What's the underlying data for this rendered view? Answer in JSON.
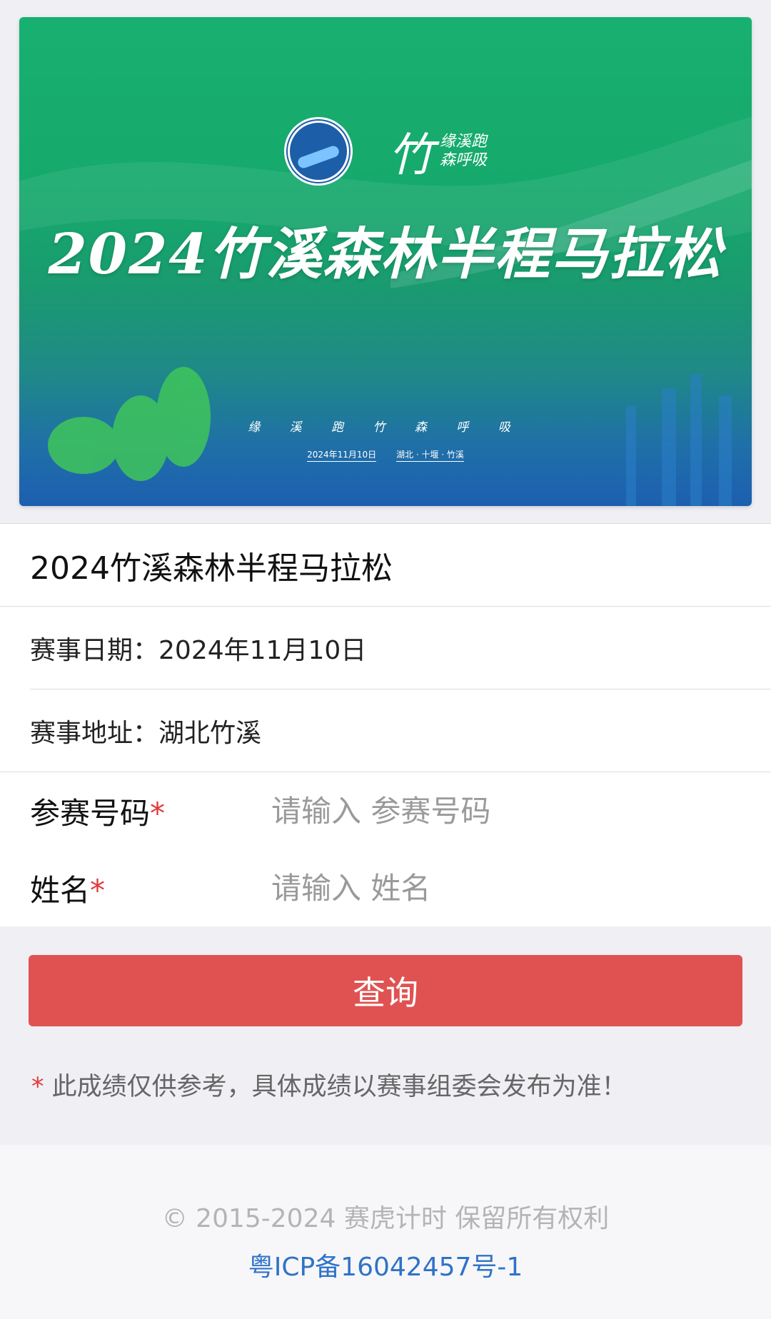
{
  "banner": {
    "title": "2024竹溪森林半程马拉松",
    "logo_text_small": "缘溪跑\n森呼吸",
    "logo_text_big": "竹",
    "slogan": "缘 溪 跑 竹 森 呼 吸",
    "date": "2024年11月10日",
    "place": "湖北 · 十堰 · 竹溪"
  },
  "event": {
    "title": "2024竹溪森林半程马拉松",
    "date_label": "赛事日期：",
    "date_value": "2024年11月10日",
    "address_label": "赛事地址：",
    "address_value": "湖北竹溪"
  },
  "form": {
    "bib_label": "参赛号码",
    "bib_placeholder": "请输入 参赛号码",
    "name_label": "姓名",
    "name_placeholder": "请输入 姓名",
    "required_mark": "*",
    "query_button": "查询"
  },
  "note": {
    "mark": "*",
    "text": " 此成绩仅供参考，具体成绩以赛事组委会发布为准！"
  },
  "footer": {
    "copyright": "© 2015-2024 赛虎计时 保留所有权利",
    "icp": "粤ICP备16042457号-1",
    "link_color": "#2f73c7"
  },
  "colors": {
    "accent": "#e05252",
    "banner_green": "#18b070",
    "banner_blue": "#1d5fb0"
  }
}
